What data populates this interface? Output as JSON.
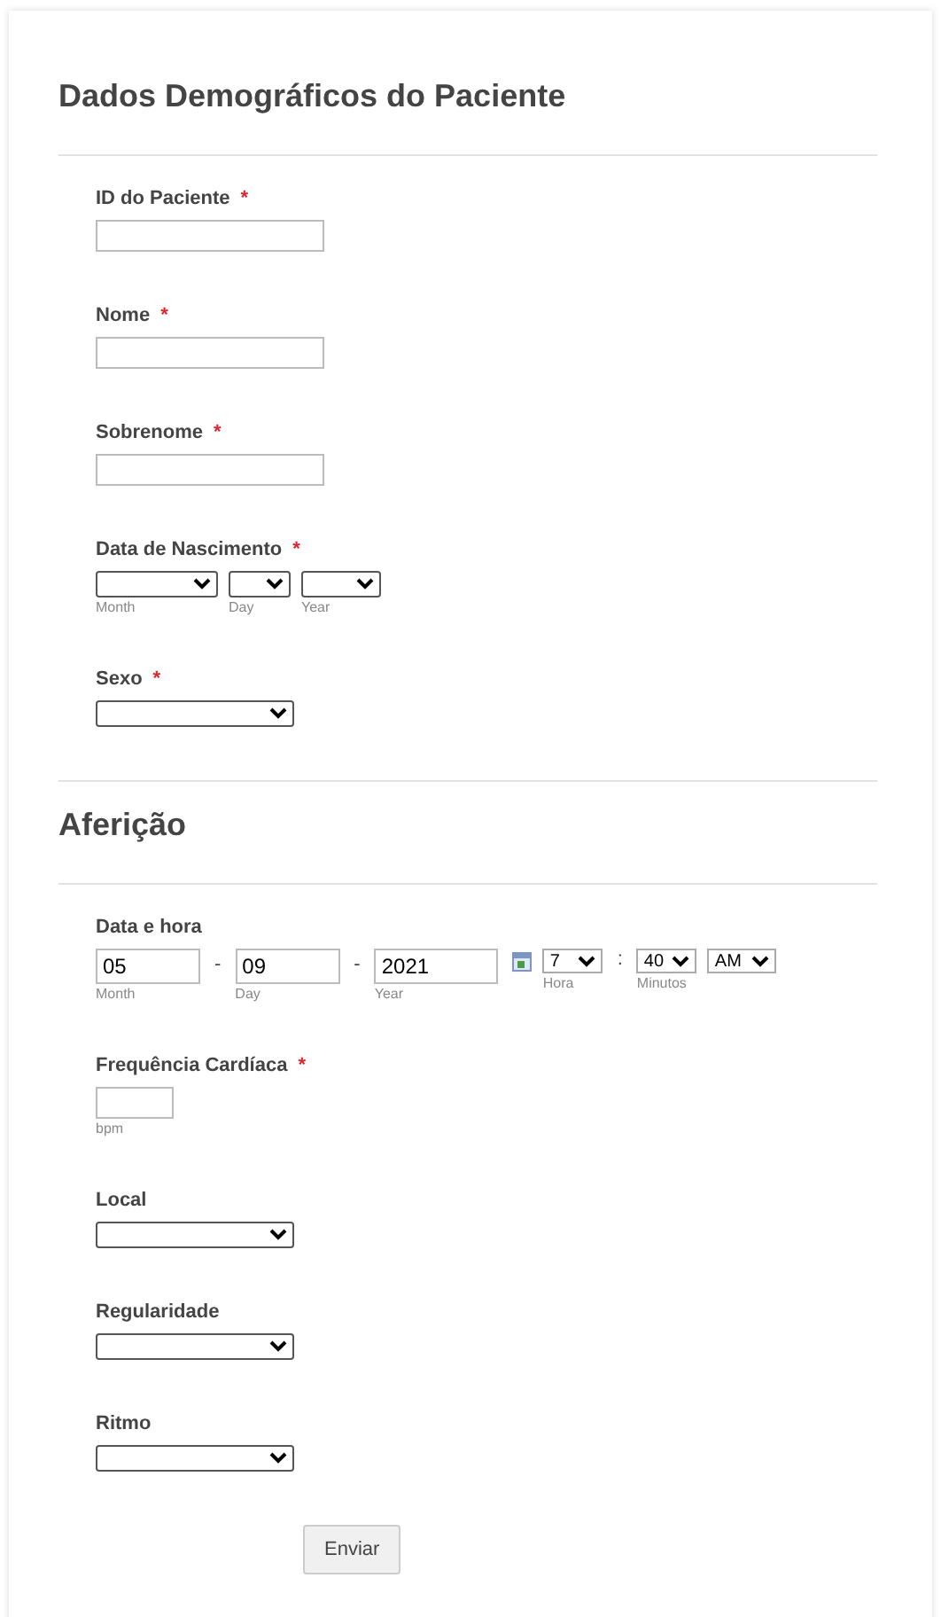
{
  "sections": [
    {
      "title": "Dados Demográficos do Paciente",
      "fields": [
        {
          "kind": "text",
          "label": "ID do Paciente",
          "mark": "*",
          "parts": [
            {
              "kind": "input"
            }
          ]
        },
        {
          "kind": "text",
          "label": "Nome",
          "mark": "*",
          "parts": [
            {
              "kind": "input"
            }
          ]
        },
        {
          "kind": "text",
          "label": "Sobrenome",
          "mark": "*",
          "parts": [
            {
              "kind": "input"
            }
          ]
        },
        {
          "kind": "date",
          "label": "Data de Nascimento",
          "mark": "*",
          "parts": [
            {
              "kind": "select",
              "sublabel": "Month"
            },
            {
              "kind": "select",
              "sublabel": "Day"
            },
            {
              "kind": "select",
              "sublabel": "Year"
            }
          ]
        },
        {
          "kind": "select",
          "label": "Sexo",
          "mark": "*",
          "parts": [
            {
              "kind": "select"
            }
          ]
        }
      ]
    },
    {
      "title": "Aferição",
      "fields": [
        {
          "kind": "datetime",
          "label": "Data e hora",
          "parts": [
            {
              "kind": "input",
              "value": "05",
              "sublabel": "Month"
            },
            {
              "kind": "separator",
              "value": "-"
            },
            {
              "kind": "input",
              "value": "09",
              "sublabel": "Day"
            },
            {
              "kind": "separator",
              "value": "-"
            },
            {
              "kind": "input",
              "value": "2021",
              "sublabel": "Year"
            },
            {
              "kind": "calendar"
            },
            {
              "kind": "select",
              "value": "7",
              "sublabel": "Hora"
            },
            {
              "kind": "separator",
              "value": ":"
            },
            {
              "kind": "select",
              "value": "40",
              "sublabel": "Minutos"
            },
            {
              "kind": "select",
              "value": "AM"
            }
          ]
        },
        {
          "kind": "number",
          "label": "Frequência Cardíaca",
          "mark": "*",
          "parts": [
            {
              "kind": "input",
              "sublabel": "bpm"
            }
          ]
        },
        {
          "kind": "select",
          "label": "Local",
          "parts": [
            {
              "kind": "select"
            }
          ]
        },
        {
          "kind": "select",
          "label": "Regularidade",
          "parts": [
            {
              "kind": "select"
            }
          ]
        },
        {
          "kind": "select",
          "label": "Ritmo",
          "parts": [
            {
              "kind": "select"
            }
          ]
        }
      ]
    }
  ],
  "submit": "Enviar"
}
